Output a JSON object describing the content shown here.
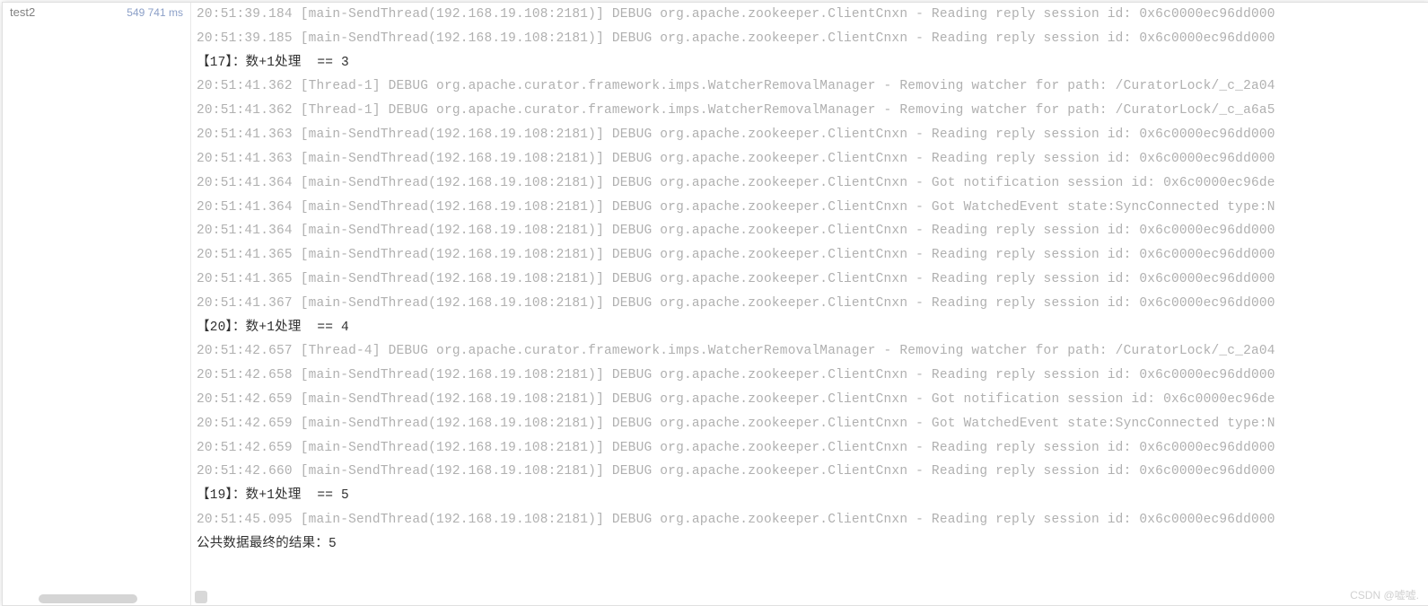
{
  "sidebar": {
    "items": [
      {
        "name": "test2",
        "time": "549 741 ms"
      }
    ]
  },
  "console": {
    "lines": [
      {
        "type": "log",
        "text": "20:51:39.184 [main-SendThread(192.168.19.108:2181)] DEBUG org.apache.zookeeper.ClientCnxn - Reading reply session id: 0x6c0000ec96dd000"
      },
      {
        "type": "log",
        "text": "20:51:39.185 [main-SendThread(192.168.19.108:2181)] DEBUG org.apache.zookeeper.ClientCnxn - Reading reply session id: 0x6c0000ec96dd000"
      },
      {
        "type": "out",
        "text": "【17】：数+1处理  == 3"
      },
      {
        "type": "log",
        "text": "20:51:41.362 [Thread-1] DEBUG org.apache.curator.framework.imps.WatcherRemovalManager - Removing watcher for path: /CuratorLock/_c_2a04"
      },
      {
        "type": "log",
        "text": "20:51:41.362 [Thread-1] DEBUG org.apache.curator.framework.imps.WatcherRemovalManager - Removing watcher for path: /CuratorLock/_c_a6a5"
      },
      {
        "type": "log",
        "text": "20:51:41.363 [main-SendThread(192.168.19.108:2181)] DEBUG org.apache.zookeeper.ClientCnxn - Reading reply session id: 0x6c0000ec96dd000"
      },
      {
        "type": "log",
        "text": "20:51:41.363 [main-SendThread(192.168.19.108:2181)] DEBUG org.apache.zookeeper.ClientCnxn - Reading reply session id: 0x6c0000ec96dd000"
      },
      {
        "type": "log",
        "text": "20:51:41.364 [main-SendThread(192.168.19.108:2181)] DEBUG org.apache.zookeeper.ClientCnxn - Got notification session id: 0x6c0000ec96de"
      },
      {
        "type": "log",
        "text": "20:51:41.364 [main-SendThread(192.168.19.108:2181)] DEBUG org.apache.zookeeper.ClientCnxn - Got WatchedEvent state:SyncConnected type:N"
      },
      {
        "type": "log",
        "text": "20:51:41.364 [main-SendThread(192.168.19.108:2181)] DEBUG org.apache.zookeeper.ClientCnxn - Reading reply session id: 0x6c0000ec96dd000"
      },
      {
        "type": "log",
        "text": "20:51:41.365 [main-SendThread(192.168.19.108:2181)] DEBUG org.apache.zookeeper.ClientCnxn - Reading reply session id: 0x6c0000ec96dd000"
      },
      {
        "type": "log",
        "text": "20:51:41.365 [main-SendThread(192.168.19.108:2181)] DEBUG org.apache.zookeeper.ClientCnxn - Reading reply session id: 0x6c0000ec96dd000"
      },
      {
        "type": "log",
        "text": "20:51:41.367 [main-SendThread(192.168.19.108:2181)] DEBUG org.apache.zookeeper.ClientCnxn - Reading reply session id: 0x6c0000ec96dd000"
      },
      {
        "type": "out",
        "text": "【20】：数+1处理  == 4"
      },
      {
        "type": "log",
        "text": "20:51:42.657 [Thread-4] DEBUG org.apache.curator.framework.imps.WatcherRemovalManager - Removing watcher for path: /CuratorLock/_c_2a04"
      },
      {
        "type": "log",
        "text": "20:51:42.658 [main-SendThread(192.168.19.108:2181)] DEBUG org.apache.zookeeper.ClientCnxn - Reading reply session id: 0x6c0000ec96dd000"
      },
      {
        "type": "log",
        "text": "20:51:42.659 [main-SendThread(192.168.19.108:2181)] DEBUG org.apache.zookeeper.ClientCnxn - Got notification session id: 0x6c0000ec96de"
      },
      {
        "type": "log",
        "text": "20:51:42.659 [main-SendThread(192.168.19.108:2181)] DEBUG org.apache.zookeeper.ClientCnxn - Got WatchedEvent state:SyncConnected type:N"
      },
      {
        "type": "log",
        "text": "20:51:42.659 [main-SendThread(192.168.19.108:2181)] DEBUG org.apache.zookeeper.ClientCnxn - Reading reply session id: 0x6c0000ec96dd000"
      },
      {
        "type": "log",
        "text": "20:51:42.660 [main-SendThread(192.168.19.108:2181)] DEBUG org.apache.zookeeper.ClientCnxn - Reading reply session id: 0x6c0000ec96dd000"
      },
      {
        "type": "out",
        "text": "【19】：数+1处理  == 5"
      },
      {
        "type": "log",
        "text": "20:51:45.095 [main-SendThread(192.168.19.108:2181)] DEBUG org.apache.zookeeper.ClientCnxn - Reading reply session id: 0x6c0000ec96dd000"
      },
      {
        "type": "out",
        "text": "公共数据最终的结果：5"
      }
    ]
  },
  "watermark": "CSDN @嘘嘘."
}
